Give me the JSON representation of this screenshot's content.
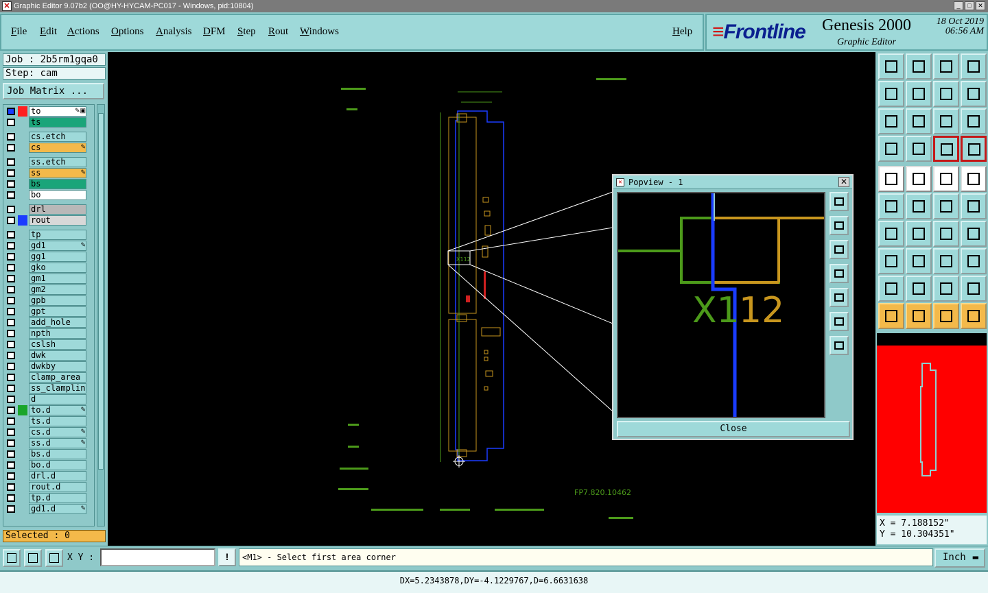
{
  "window": {
    "title": "Graphic Editor 9.07b2 (OO@HY-HYCAM-PC017 - Windows, pid:10804)"
  },
  "menu": {
    "file": "File",
    "edit": "Edit",
    "actions": "Actions",
    "options": "Options",
    "analysis": "Analysis",
    "dfm": "DFM",
    "step": "Step",
    "rout": "Rout",
    "windows": "Windows",
    "help": "Help"
  },
  "brand": {
    "logo": "Frontline",
    "product": "Genesis 2000",
    "subtitle": "Graphic Editor",
    "date": "18 Oct 2019",
    "time": "06:56 AM"
  },
  "job": {
    "job_label": "Job : 2b5rm1gqa0",
    "step_label": "Step: cam",
    "matrix_button": "Job Matrix ..."
  },
  "layers": [
    {
      "name": "to",
      "swatch_color": "#ff2020",
      "name_bg": "#ffffff",
      "active": true,
      "mark": "✎▣"
    },
    {
      "name": "ts",
      "swatch_color": "",
      "name_bg": "#1aa57a",
      "active": false,
      "mark": ""
    },
    {
      "name": "cs.etch",
      "swatch_color": "",
      "name_bg": "#9ed9d9",
      "active": false,
      "mark": ""
    },
    {
      "name": "cs",
      "swatch_color": "",
      "name_bg": "#f3b94a",
      "active": false,
      "mark": "✎"
    },
    {
      "name": "ss.etch",
      "swatch_color": "",
      "name_bg": "#9ed9d9",
      "active": false,
      "mark": ""
    },
    {
      "name": "ss",
      "swatch_color": "",
      "name_bg": "#f3b94a",
      "active": false,
      "mark": "✎"
    },
    {
      "name": "bs",
      "swatch_color": "",
      "name_bg": "#1aa57a",
      "active": false,
      "mark": ""
    },
    {
      "name": "bo",
      "swatch_color": "",
      "name_bg": "#ffffff",
      "active": false,
      "mark": ""
    },
    {
      "name": "drl",
      "swatch_color": "",
      "name_bg": "#b8b8b8",
      "active": false,
      "mark": ""
    },
    {
      "name": "rout",
      "swatch_color": "#1a3cff",
      "name_bg": "#d8d8d8",
      "active": false,
      "mark": ""
    },
    {
      "name": "tp",
      "swatch_color": "",
      "name_bg": "#9ed9d9",
      "active": false,
      "mark": ""
    },
    {
      "name": "gd1",
      "swatch_color": "",
      "name_bg": "#9ed9d9",
      "active": false,
      "mark": "✎"
    },
    {
      "name": "gg1",
      "swatch_color": "",
      "name_bg": "#9ed9d9",
      "active": false,
      "mark": ""
    },
    {
      "name": "gko",
      "swatch_color": "",
      "name_bg": "#9ed9d9",
      "active": false,
      "mark": ""
    },
    {
      "name": "gm1",
      "swatch_color": "",
      "name_bg": "#9ed9d9",
      "active": false,
      "mark": ""
    },
    {
      "name": "gm2",
      "swatch_color": "",
      "name_bg": "#9ed9d9",
      "active": false,
      "mark": ""
    },
    {
      "name": "gpb",
      "swatch_color": "",
      "name_bg": "#9ed9d9",
      "active": false,
      "mark": ""
    },
    {
      "name": "gpt",
      "swatch_color": "",
      "name_bg": "#9ed9d9",
      "active": false,
      "mark": ""
    },
    {
      "name": "add_hole",
      "swatch_color": "",
      "name_bg": "#9ed9d9",
      "active": false,
      "mark": ""
    },
    {
      "name": "npth",
      "swatch_color": "",
      "name_bg": "#9ed9d9",
      "active": false,
      "mark": ""
    },
    {
      "name": "cslsh",
      "swatch_color": "",
      "name_bg": "#9ed9d9",
      "active": false,
      "mark": ""
    },
    {
      "name": "dwk",
      "swatch_color": "",
      "name_bg": "#9ed9d9",
      "active": false,
      "mark": ""
    },
    {
      "name": "dwkby",
      "swatch_color": "",
      "name_bg": "#9ed9d9",
      "active": false,
      "mark": ""
    },
    {
      "name": "clamp_area",
      "swatch_color": "",
      "name_bg": "#9ed9d9",
      "active": false,
      "mark": ""
    },
    {
      "name": "ss_clampline",
      "swatch_color": "",
      "name_bg": "#9ed9d9",
      "active": false,
      "mark": ""
    },
    {
      "name": "d",
      "swatch_color": "",
      "name_bg": "#9ed9d9",
      "active": false,
      "mark": ""
    },
    {
      "name": "to.d",
      "swatch_color": "#1aa52a",
      "name_bg": "#9ed9d9",
      "active": false,
      "mark": "✎"
    },
    {
      "name": "ts.d",
      "swatch_color": "",
      "name_bg": "#9ed9d9",
      "active": false,
      "mark": ""
    },
    {
      "name": "cs.d",
      "swatch_color": "",
      "name_bg": "#9ed9d9",
      "active": false,
      "mark": "✎"
    },
    {
      "name": "ss.d",
      "swatch_color": "",
      "name_bg": "#9ed9d9",
      "active": false,
      "mark": "✎"
    },
    {
      "name": "bs.d",
      "swatch_color": "",
      "name_bg": "#9ed9d9",
      "active": false,
      "mark": ""
    },
    {
      "name": "bo.d",
      "swatch_color": "",
      "name_bg": "#9ed9d9",
      "active": false,
      "mark": ""
    },
    {
      "name": "drl.d",
      "swatch_color": "",
      "name_bg": "#9ed9d9",
      "active": false,
      "mark": ""
    },
    {
      "name": "rout.d",
      "swatch_color": "",
      "name_bg": "#9ed9d9",
      "active": false,
      "mark": ""
    },
    {
      "name": "tp.d",
      "swatch_color": "",
      "name_bg": "#9ed9d9",
      "active": false,
      "mark": ""
    },
    {
      "name": "gd1.d",
      "swatch_color": "",
      "name_bg": "#9ed9d9",
      "active": false,
      "mark": "✎"
    }
  ],
  "selected_label": "Selected : 0",
  "canvas": {
    "board_text": "X112",
    "part_number": "FP7.820.10462"
  },
  "popview": {
    "title": "Popview - 1",
    "zoom_text_green": "X1",
    "zoom_text_gold": "12",
    "close_button": "Close"
  },
  "tool_icons": [
    "zoom-home-icon",
    "zoom-in-icon",
    "home-icon",
    "window-icon",
    "pan-left-icon",
    "pan-right-icon",
    "swap-icon",
    "snap-icon",
    "fit-icon",
    "center-icon",
    "one-to-one-icon",
    "help-icon",
    "settings-icon",
    "measure-icon",
    "layer-select-icon",
    "layer-select-alt-icon",
    "feature-icon",
    "line-draw-icon",
    "ruler-icon",
    "pad-icon",
    "connect-icon",
    "delete-icon",
    "move-icon",
    "copy-icon",
    "angle-icon",
    "line-icon",
    "arc-icon",
    "split-icon",
    "polygon-icon",
    "cut-icon",
    "measure-dist-icon",
    "shape-icon",
    "triangle-icon",
    "triangle-alt-icon",
    "arch-icon",
    "arch-alt-icon",
    "pointer-icon",
    "pointer-box-icon",
    "pointer-select-icon",
    "route-icon"
  ],
  "coords": {
    "x": "X = 7.188152\"",
    "y": "Y = 10.304351\""
  },
  "bottom": {
    "xy_label": "X Y :",
    "xy_value": "",
    "warn_symbol": "!",
    "prompt": "<M1> - Select first area corner",
    "unit": "Inch"
  },
  "status_line": "DX=5.2343878,DY=-4.1229767,D=6.6631638",
  "colors": {
    "panel": "#8fc9c9",
    "panel_light": "#9ed9d9",
    "board_outline": "#1a3cff",
    "copper": "#c8961e",
    "silkscreen": "#4c9a1a",
    "accent_red": "#ff0000"
  }
}
